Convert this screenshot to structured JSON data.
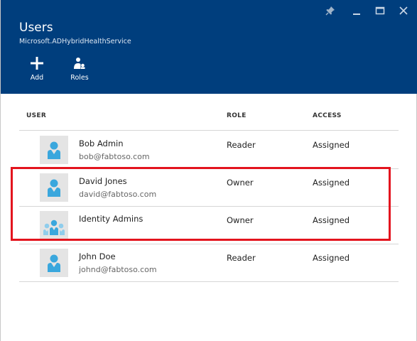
{
  "blade": {
    "title": "Users",
    "subtitle": "Microsoft.ADHybridHealthService",
    "header_color": "#003e7d"
  },
  "window_controls": [
    {
      "name": "pin-icon"
    },
    {
      "name": "minimize-icon"
    },
    {
      "name": "maximize-icon"
    },
    {
      "name": "close-icon"
    }
  ],
  "commands": {
    "add_label": "Add",
    "add_icon": "plus-icon",
    "roles_label": "Roles",
    "roles_icon": "roles-icon"
  },
  "table": {
    "columns": {
      "user": "USER",
      "role": "ROLE",
      "access": "ACCESS"
    },
    "rows": [
      {
        "name": "Bob Admin",
        "email": "bob@fabtoso.com",
        "role": "Reader",
        "access": "Assigned",
        "icon": "user-icon"
      },
      {
        "name": "David Jones",
        "email": "david@fabtoso.com",
        "role": "Owner",
        "access": "Assigned",
        "icon": "user-icon"
      },
      {
        "name": "Identity Admins",
        "email": "",
        "role": "Owner",
        "access": "Assigned",
        "icon": "group-icon"
      },
      {
        "name": "John Doe",
        "email": "johnd@fabtoso.com",
        "role": "Reader",
        "access": "Assigned",
        "icon": "user-icon"
      }
    ]
  },
  "highlight_color": "#e3141e",
  "avatar_color": "#3aa7dd"
}
